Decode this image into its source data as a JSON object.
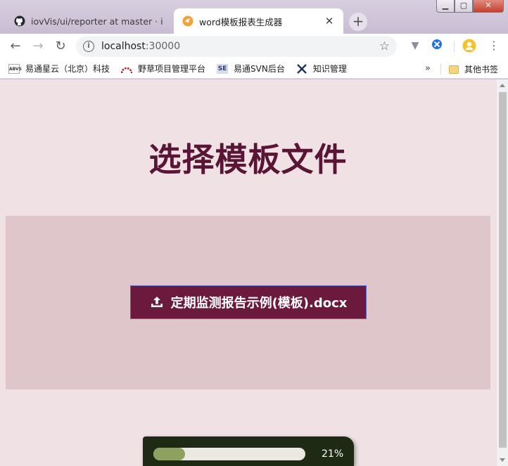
{
  "window": {
    "minimize_label": "▁",
    "maximize_label": "▢",
    "close_label": "✕"
  },
  "tabs": [
    {
      "title": "iovVis/ui/reporter at master · i",
      "active": false,
      "icon": "github-icon"
    },
    {
      "title": "word模板报表生成器",
      "active": true,
      "icon": "app-favicon-icon"
    }
  ],
  "toolbar": {
    "url_host": "localhost",
    "url_port": ":30000"
  },
  "bookmarks": [
    {
      "label": "易通星云（北京）科技",
      "icon": "abvs-icon",
      "icon_text": "ABVS"
    },
    {
      "label": "野草项目管理平台",
      "icon": "redmine-icon",
      "icon_text": ""
    },
    {
      "label": "易通SVN后台",
      "icon": "svn-icon",
      "icon_text": "SE"
    },
    {
      "label": "知识管理",
      "icon": "knowledge-icon",
      "icon_text": ""
    }
  ],
  "bookmarks_more": "»",
  "other_bookmarks": "其他书签",
  "page": {
    "title": "选择模板文件",
    "upload_button_label": "定期监测报告示例(模板).docx",
    "progress_percent": 21,
    "progress_text": "21%"
  },
  "colors": {
    "page_bg": "#f0e2e4",
    "dropzone_bg": "#dfc6ca",
    "title_color": "#5a1536",
    "button_bg": "#6b1a3d",
    "progress_fill": "#8da25e"
  }
}
